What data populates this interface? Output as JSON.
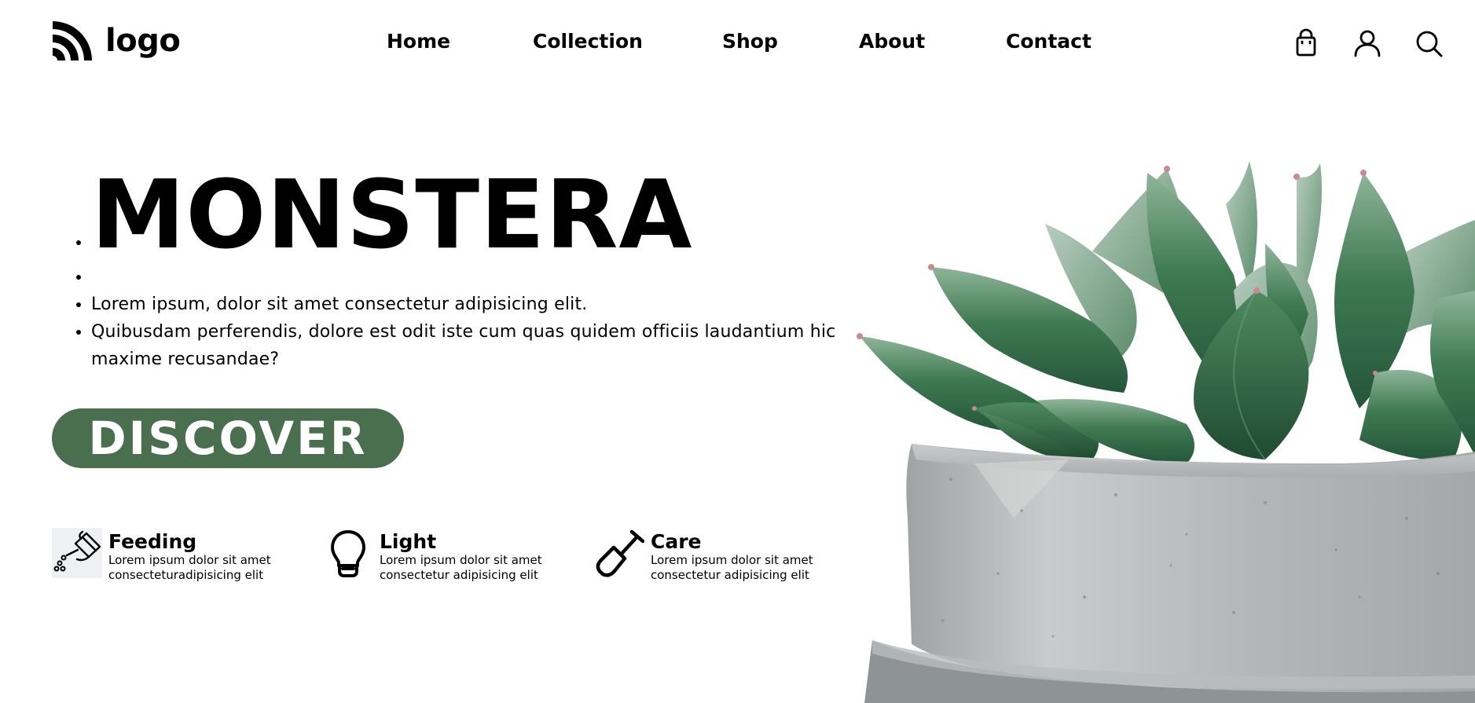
{
  "header": {
    "logo_text": "logo",
    "nav": [
      "Home",
      "Collection",
      "Shop",
      "About",
      "Contact"
    ],
    "icons": [
      "shopping-bag-icon",
      "user-icon",
      "search-icon"
    ]
  },
  "hero": {
    "title": "MONSTERA",
    "paragraphs": [
      "Lorem ipsum, dolor sit amet consectetur adipisicing elit.",
      "Quibusdam perferendis, dolore est odit iste cum quas quidem officiis laudantium hic maxime recusandae?"
    ],
    "cta_label": "DISCOVER"
  },
  "features": [
    {
      "icon": "watering-can-icon",
      "title": "Feeding",
      "desc_line1": "Lorem ipsum dolor sit amet",
      "desc_line2": "consecteturadipisicing elit"
    },
    {
      "icon": "light-bulb-icon",
      "title": "Light",
      "desc_line1": "Lorem ipsum dolor sit amet",
      "desc_line2": "consectetur adipisicing elit"
    },
    {
      "icon": "shovel-icon",
      "title": "Care",
      "desc_line1": "Lorem ipsum dolor sit amet",
      "desc_line2": "consectetur adipisicing elit"
    }
  ],
  "colors": {
    "accent_green": "#4a6f4f",
    "text": "#000000",
    "background": "#ffffff"
  }
}
